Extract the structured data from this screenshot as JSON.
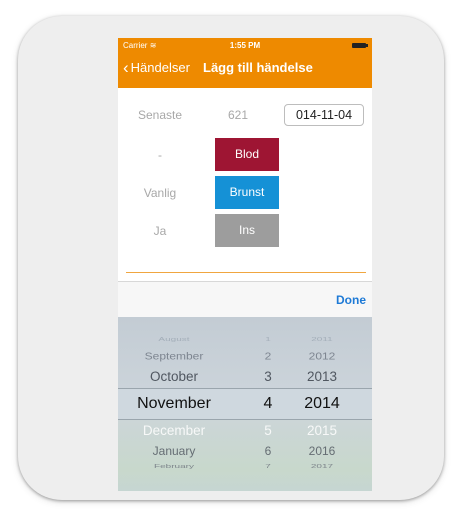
{
  "status": {
    "carrier": "Carrier",
    "time": "1:55 PM"
  },
  "nav": {
    "back_label": "Händelser",
    "title": "Lägg till händelse"
  },
  "form": {
    "row1": {
      "label": "Senaste",
      "value": "621",
      "date": "014-11-04"
    },
    "row2": {
      "label": "-",
      "button": "Blod"
    },
    "row3": {
      "label": "Vanlig",
      "button": "Brunst"
    },
    "row4": {
      "label": "Ja",
      "button": "Ins"
    }
  },
  "toolbar": {
    "done_label": "Done"
  },
  "picker": {
    "rows": [
      {
        "month": "August",
        "day": "1",
        "year": "2011"
      },
      {
        "month": "September",
        "day": "2",
        "year": "2012"
      },
      {
        "month": "October",
        "day": "3",
        "year": "2013"
      },
      {
        "month": "November",
        "day": "4",
        "year": "2014"
      },
      {
        "month": "December",
        "day": "5",
        "year": "2015"
      },
      {
        "month": "January",
        "day": "6",
        "year": "2016"
      },
      {
        "month": "February",
        "day": "7",
        "year": "2017"
      }
    ]
  },
  "colors": {
    "accent": "#ee8a00",
    "blod": "#9e1533",
    "brunst": "#1591d6",
    "ins": "#9d9d9d",
    "done": "#1e7ad6"
  }
}
